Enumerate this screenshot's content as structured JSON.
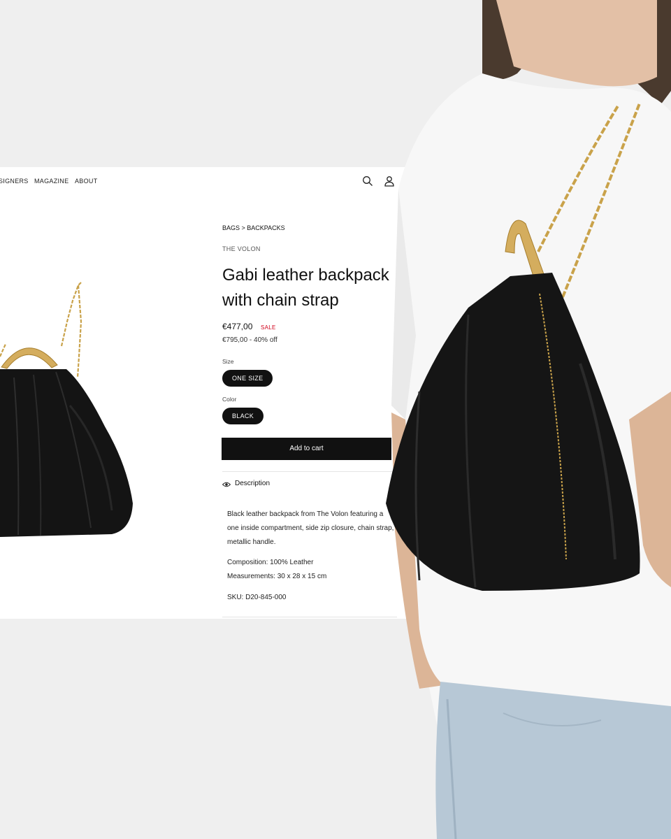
{
  "nav": {
    "items": [
      "SIGNERS",
      "MAGAZINE",
      "ABOUT"
    ]
  },
  "icons": {
    "search": "search-icon",
    "account": "user-icon",
    "description": "eye-icon"
  },
  "breadcrumb": "BAGS > BACKPACKS",
  "product": {
    "brand": "THE VOLON",
    "title": "Gabi leather backpack with chain strap",
    "price": "€477,00",
    "sale_badge": "SALE",
    "old_price_line": "€795,00 - 40% off",
    "size_label": "Size",
    "size_value": "ONE SIZE",
    "color_label": "Color",
    "color_value": "BLACK",
    "add_to_cart": "Add to cart"
  },
  "description": {
    "heading": "Description",
    "text": "Black leather backpack from The Volon featuring a one inside compartment, side zip closure, chain strap, metallic handle.",
    "composition": "Composition: 100% Leather",
    "measurements": "Measurements: 30 x 28 x 15 cm",
    "sku": "SKU: D20-845-000"
  },
  "colors": {
    "sale": "#d0021b",
    "button": "#111111",
    "background": "#efefef",
    "gold": "#c9a24a"
  }
}
